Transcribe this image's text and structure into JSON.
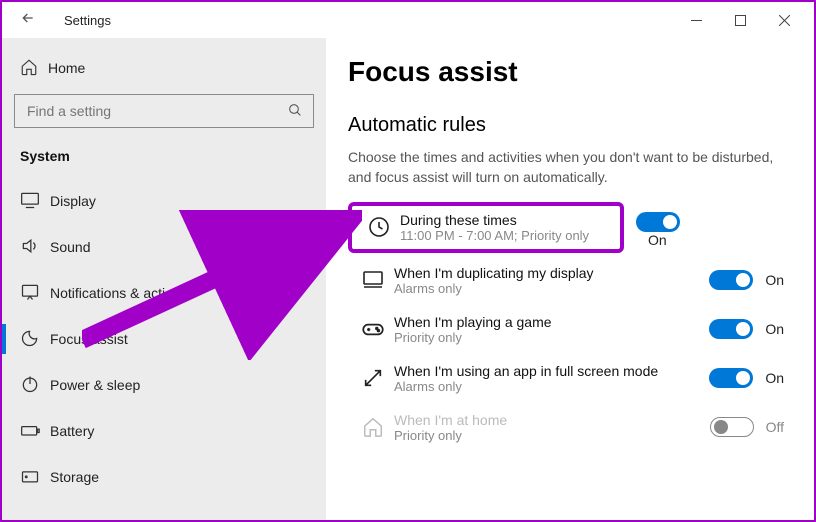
{
  "window": {
    "title": "Settings"
  },
  "sidebar": {
    "home": "Home",
    "search_placeholder": "Find a setting",
    "section": "System",
    "items": [
      {
        "label": "Display"
      },
      {
        "label": "Sound"
      },
      {
        "label": "Notifications & actions"
      },
      {
        "label": "Focus assist"
      },
      {
        "label": "Power & sleep"
      },
      {
        "label": "Battery"
      },
      {
        "label": "Storage"
      }
    ]
  },
  "main": {
    "title": "Focus assist",
    "section": "Automatic rules",
    "description": "Choose the times and activities when you don't want to be disturbed, and focus assist will turn on automatically.",
    "rules": [
      {
        "title": "During these times",
        "sub": "11:00 PM - 7:00 AM; Priority only",
        "state": "On"
      },
      {
        "title": "When I'm duplicating my display",
        "sub": "Alarms only",
        "state": "On"
      },
      {
        "title": "When I'm playing a game",
        "sub": "Priority only",
        "state": "On"
      },
      {
        "title": "When I'm using an app in full screen mode",
        "sub": "Alarms only",
        "state": "On"
      },
      {
        "title": "When I'm at home",
        "sub": "Priority only",
        "state": "Off"
      }
    ]
  }
}
